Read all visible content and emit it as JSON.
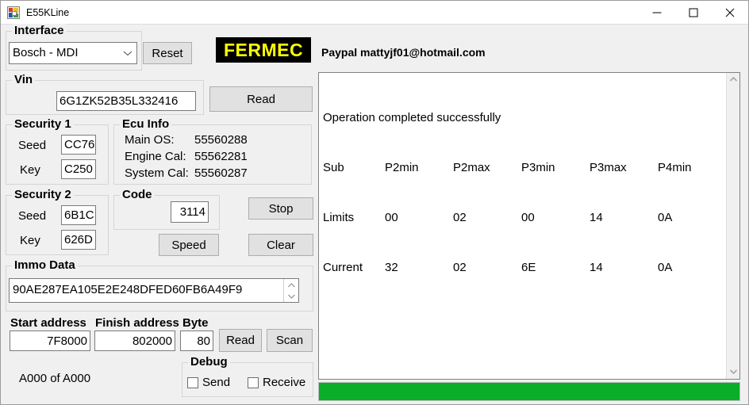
{
  "window": {
    "title": "E55KLine",
    "icon": "app-window-icon",
    "minimize_label": "—",
    "maximize_label": "□",
    "close_label": "✕"
  },
  "branding": {
    "logo_text": "FERMEC",
    "logo_bg": "#000000",
    "logo_fg": "#ffff00",
    "paypal_text": "Paypal mattyjf01@hotmail.com"
  },
  "interface": {
    "group_label": "Interface",
    "selected": "Bosch - MDI",
    "options": [
      "Bosch - MDI"
    ],
    "reset_label": "Reset"
  },
  "vin": {
    "group_label": "Vin",
    "value": "6G1ZK52B35L332416",
    "read_label": "Read"
  },
  "security1": {
    "group_label": "Security 1",
    "seed_label": "Seed",
    "seed_value": "CC76",
    "key_label": "Key",
    "key_value": "C250"
  },
  "security2": {
    "group_label": "Security 2",
    "seed_label": "Seed",
    "seed_value": "6B1C",
    "key_label": "Key",
    "key_value": "626D"
  },
  "ecu_info": {
    "group_label": "Ecu Info",
    "rows": [
      {
        "label": "Main OS:",
        "value": "55560288"
      },
      {
        "label": "Engine Cal:",
        "value": "55562281"
      },
      {
        "label": "System Cal:",
        "value": "55560287"
      }
    ]
  },
  "code": {
    "group_label": "Code",
    "value": "3114",
    "speed_label": "Speed"
  },
  "actions": {
    "stop_label": "Stop",
    "clear_label": "Clear"
  },
  "immo": {
    "group_label": "Immo Data",
    "value": "90AE287EA105E2E248DFED60FB6A49F9",
    "spinner_up": "up-arrow-icon",
    "spinner_down": "down-arrow-icon"
  },
  "memory": {
    "start_label": "Start address",
    "start_value": "7F8000",
    "finish_label": "Finish address",
    "finish_value": "802000",
    "byte_label": "Byte",
    "byte_value": "80",
    "read_label": "Read",
    "scan_label": "Scan",
    "status": "A000 of A000"
  },
  "debug": {
    "group_label": "Debug",
    "send_label": "Send",
    "send_checked": false,
    "receive_label": "Receive",
    "receive_checked": false
  },
  "log": {
    "status_line": "Operation completed successfully",
    "headers": [
      "Sub",
      "P2min",
      "P2max",
      "P3min",
      "P3max",
      "P4min"
    ],
    "rows": [
      {
        "name": "Limits",
        "values": [
          "00",
          "02",
          "00",
          "14",
          "0A"
        ]
      },
      {
        "name": "Current",
        "values": [
          "32",
          "02",
          "6E",
          "14",
          "0A"
        ]
      }
    ],
    "scroll_up": "scroll-up-icon",
    "scroll_down": "scroll-down-icon"
  },
  "progress": {
    "percent": 100,
    "color": "#0bae28"
  }
}
